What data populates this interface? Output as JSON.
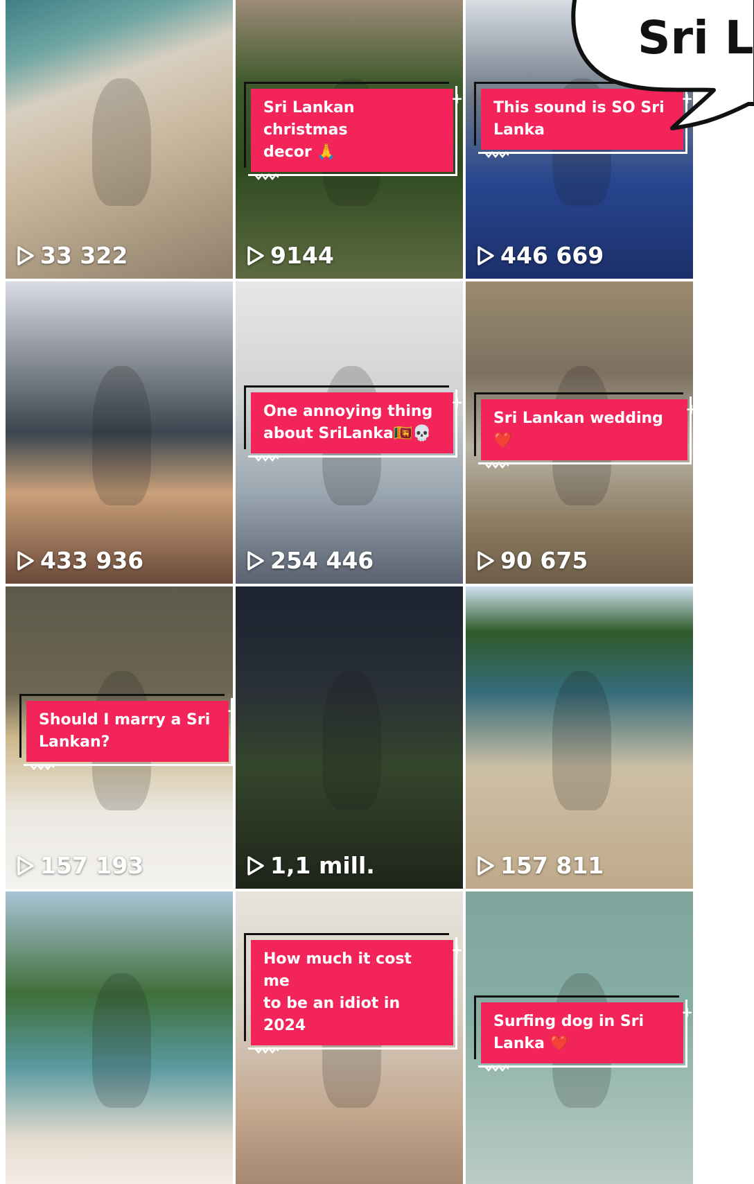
{
  "tiles": [
    {
      "views": "33 322",
      "caption": null,
      "bg": "linear-gradient(160deg,#3f7f86 0%,#6fa6a3 18%,#d8cfc1 32%,#c9b79d 55%,#a99880 80%,#8e7e6a 100%)"
    },
    {
      "views": "9144",
      "caption": [
        "Sri Lankan christmas",
        "decor 🙏"
      ],
      "bg": "linear-gradient(180deg,#9c8b78 0%,#3f5a2c 30%,#2e4a21 60%,#5d6a3f 100%)"
    },
    {
      "views": "446 669",
      "caption": [
        "This sound is SO Sri",
        "Lanka"
      ],
      "bg": "linear-gradient(180deg,#d8dde2 0%,#6d7886 35%,#27468f 65%,#1c2f6a 100%)"
    },
    {
      "views": "433 936",
      "caption": null,
      "bg": "linear-gradient(180deg,#d9dde3 0%,#8a9096 25%,#3b4650 50%,#c9a07a 70%,#6b4a3a 100%)"
    },
    {
      "views": "254 446",
      "caption": [
        "One annoying thing",
        "about SriLanka🇱🇰💀"
      ],
      "bg": "linear-gradient(180deg,#e7e7e5 0%,#cfd2d2 40%,#9aa6b0 70%,#5a6170 100%)"
    },
    {
      "views": "90 675",
      "caption": [
        "Sri Lankan wedding ❤️"
      ],
      "bg": "linear-gradient(180deg,#9a8a6e 0%,#7d7060 30%,#b8b2a3 55%,#8c7b62 80%,#6e5e48 100%)"
    },
    {
      "views": "157 193",
      "caption": [
        "Should I marry a Sri",
        "Lankan?"
      ],
      "bg": "linear-gradient(180deg,#5d5a4a 0%,#6c6652 35%,#cdb88c 50%,#ece9e3 75%,#f4f2ee 100%)"
    },
    {
      "views": "1,1 mill.",
      "caption": null,
      "bg": "linear-gradient(180deg,#1c2230 0%,#2a3036 35%,#34462c 60%,#1f2419 100%)"
    },
    {
      "views": "157 811",
      "caption": null,
      "bg": "linear-gradient(180deg,#cfe2ef 0%,#2f5a2a 15%,#356b7a 35%,#cdbfa5 60%,#bfa98a 100%)"
    },
    {
      "views": "",
      "caption": null,
      "bg": "linear-gradient(180deg,#a9c3d6 0%,#3f6f3a 35%,#5a9aa0 60%,#e6dcd0 85%,#f3ede6 100%)"
    },
    {
      "views": "",
      "caption": [
        "How much it cost me",
        "to be an idiot in 2024"
      ],
      "bg": "linear-gradient(180deg,#e8e4dc 0%,#d6cfc4 40%,#c4a88f 75%,#a48870 100%)"
    },
    {
      "views": "",
      "caption": [
        "Surfing dog in Sri",
        "Lanka ❤️"
      ],
      "bg": "linear-gradient(180deg,#7fa59c 0%,#86aea4 40%,#a0bdb4 70%,#b9cbc4 100%)"
    }
  ],
  "speech_bubble": {
    "text": "Sri L"
  },
  "icons": {
    "play": "play-outline-icon"
  }
}
